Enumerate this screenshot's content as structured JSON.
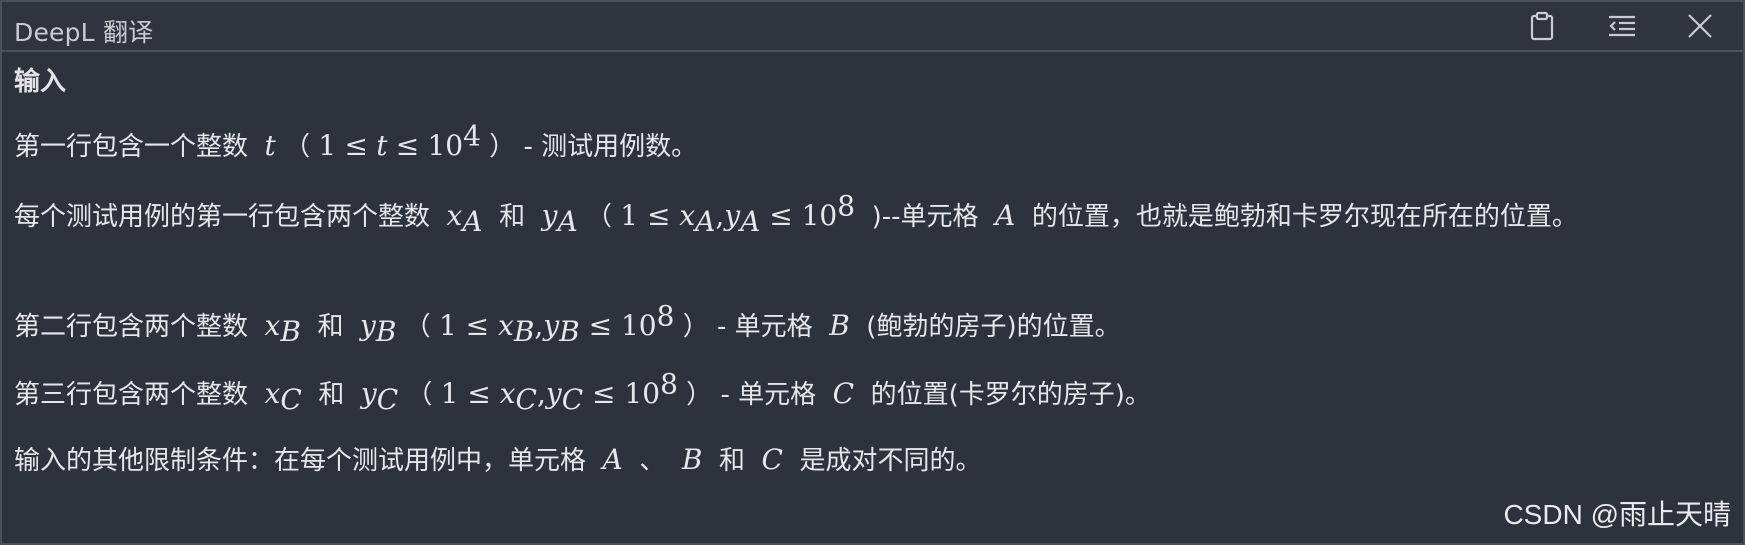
{
  "window": {
    "title": "DeepL 翻译",
    "buttons": [
      {
        "name": "clipboard-icon"
      },
      {
        "name": "menu-icon"
      },
      {
        "name": "close-icon"
      }
    ]
  },
  "content": {
    "heading": "输入",
    "p1": {
      "a": "第一行包含一个整数",
      "var_t": "t",
      "lp": "（",
      "one": "1",
      "le1": "≤",
      "t2": "t",
      "le2": "≤",
      "ten": "10",
      "exp4": "4",
      "rp": "）",
      "rest": "- 测试用例数。"
    },
    "p2": {
      "a": "每个测试用例的第一行包含两个整数",
      "xa": "x",
      "sub_a": "A",
      "and": "和",
      "ya": "y",
      "lp": "（",
      "expr_start": "1 ≤ ",
      "comma": ",",
      "le": " ≤ ",
      "ten": "10",
      "exp8": "8",
      "rest1": ")--单元格",
      "cell": "A",
      "rest2": "的位置，也就是鲍勃和卡罗尔现在所在的位置。"
    },
    "p3": {
      "a": "第二行包含两个整数",
      "xb": "x",
      "sub_b": "B",
      "and": "和",
      "yb": "y",
      "lp": "（",
      "expr_start": "1 ≤ ",
      "comma": ",",
      "le": " ≤ ",
      "ten": "10",
      "exp8": "8",
      "rp": "）",
      "rest1": "- 单元格",
      "cell": "B",
      "rest2": "(鲍勃的房子)的位置。"
    },
    "p4": {
      "a": "第三行包含两个整数",
      "xc": "x",
      "sub_c": "C",
      "and": "和",
      "yc": "y",
      "lp": "（",
      "expr_start": "1 ≤ ",
      "comma": ",",
      "le": " ≤ ",
      "ten": "10",
      "exp8": "8",
      "rp": "）",
      "rest1": "- 单元格",
      "cell": "C",
      "rest2": "的位置(卡罗尔的房子)。"
    },
    "p5": {
      "a": "输入的其他限制条件：在每个测试用例中，单元格",
      "cellA": "A",
      "sep": "、",
      "cellB": "B",
      "and": "和",
      "cellC": "C",
      "rest": "是成对不同的。"
    }
  },
  "watermark": "CSDN @雨止天晴"
}
